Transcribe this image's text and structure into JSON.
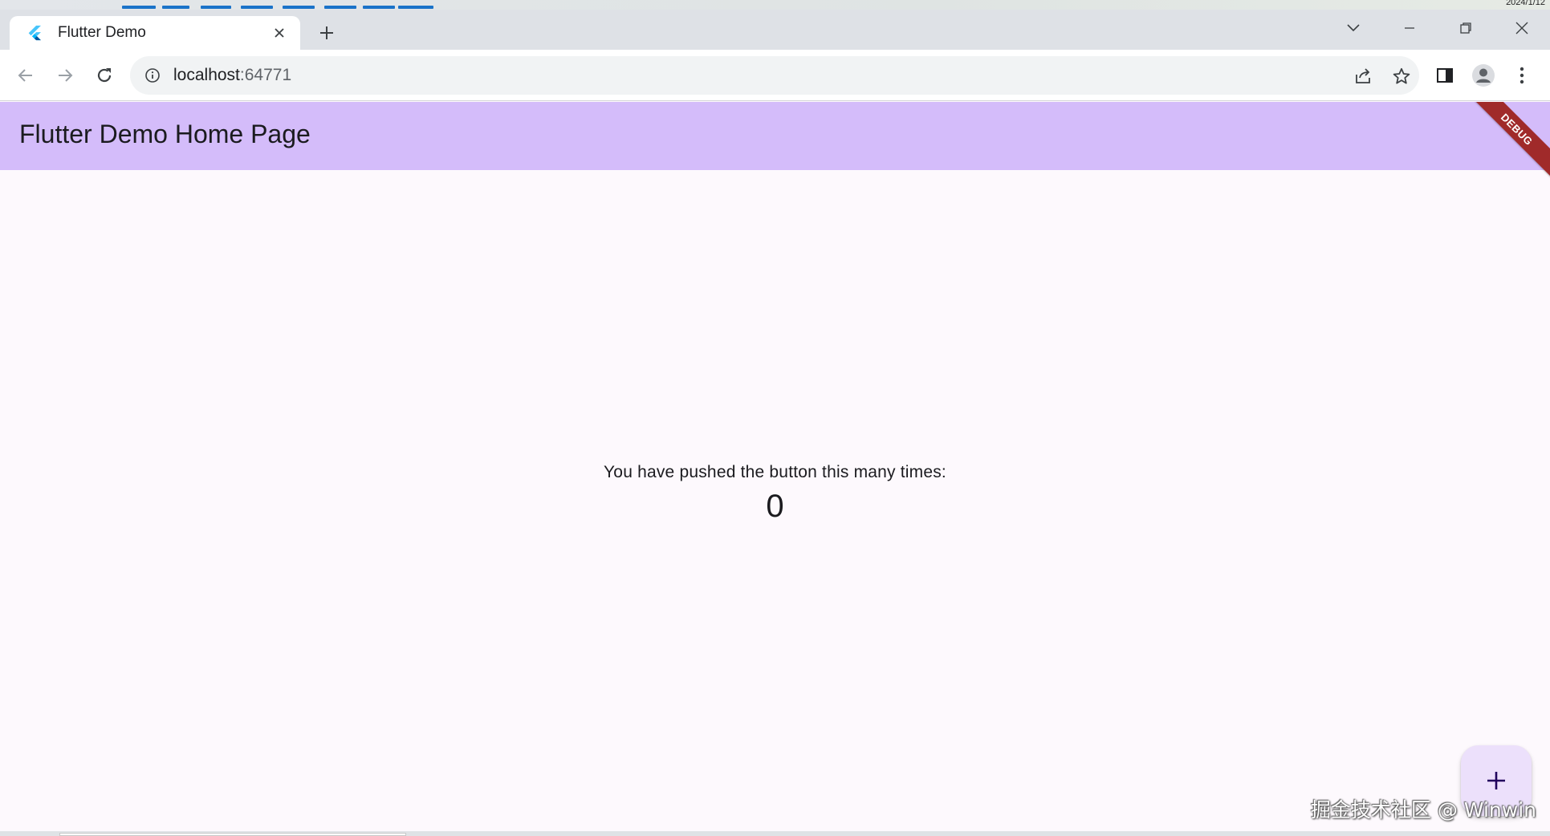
{
  "os": {
    "date_partial": "2024/1/12"
  },
  "browser": {
    "tab": {
      "title": "Flutter Demo",
      "favicon": "flutter-logo-icon",
      "close_icon": "close-icon"
    },
    "new_tab_icon": "plus-icon",
    "window_controls": [
      "chevron-down-icon",
      "minimize-icon",
      "restore-icon",
      "close-icon"
    ],
    "nav": [
      "back-arrow-icon",
      "forward-arrow-icon",
      "reload-icon"
    ],
    "address": {
      "host": "localhost",
      "port": ":64771",
      "info_icon": "info-icon"
    },
    "omnibox_actions": [
      "share-icon",
      "star-icon"
    ],
    "toolbar_actions": [
      "side-panel-icon",
      "profile-avatar-icon",
      "kebab-menu-icon"
    ]
  },
  "app": {
    "title": "Flutter Demo Home Page",
    "debug_banner": "DEBUG",
    "message": "You have pushed the button this many times:",
    "counter": "0",
    "fab_icon": "plus-icon",
    "colors": {
      "appbar": "#d4bcfa",
      "background": "#fdf9fd",
      "fab": "#ece0fb",
      "fab_icon": "#21005d",
      "debug": "#a02a2a"
    }
  },
  "overlay": {
    "watermark": "掘金技术社区 @ Winwin"
  }
}
